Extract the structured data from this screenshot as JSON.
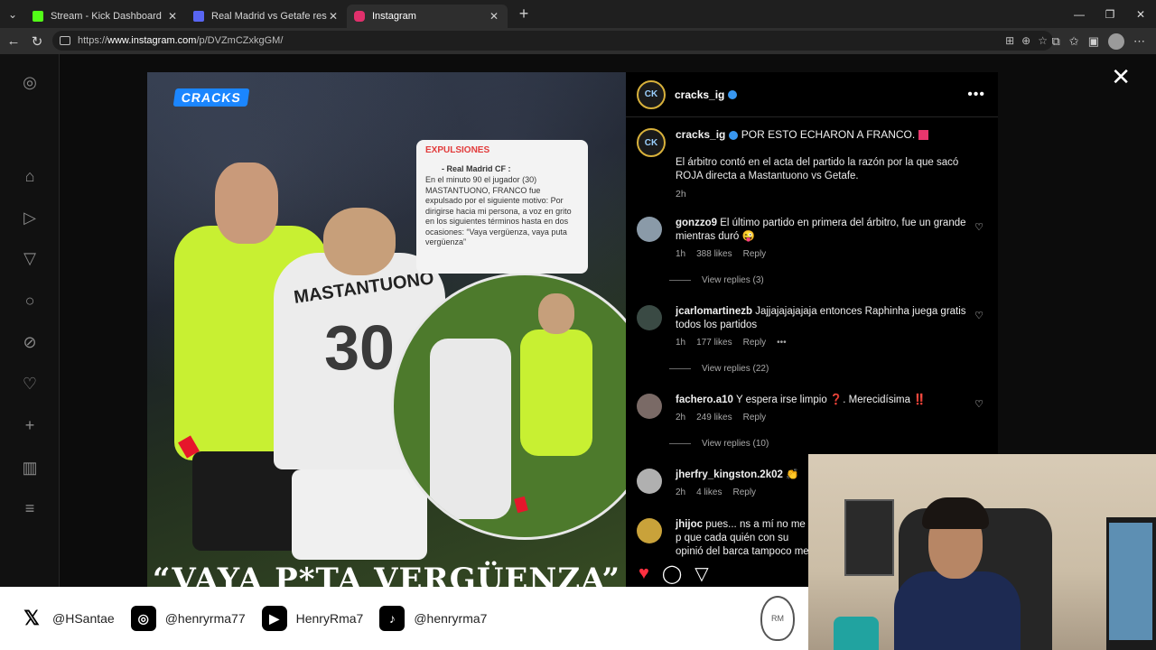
{
  "browser": {
    "tabs": [
      {
        "title": "Stream - Kick Dashboard",
        "favicon_color": "#53fc18",
        "active": false
      },
      {
        "title": "Real Madrid vs Getafe resultados d",
        "favicon_color": "#5865f2",
        "active": false
      },
      {
        "title": "Instagram",
        "favicon_color": "#e1306c",
        "active": true
      }
    ],
    "url_prefix": "https://",
    "url_host": "www.instagram.com",
    "url_path": "/p/DVZmCZxkgGM/"
  },
  "post": {
    "brand": "CRACKS",
    "doc_card": {
      "title": "EXPULSIONES",
      "subtitle": "- Real Madrid CF :",
      "body": "En el minuto 90  el jugador (30) MASTANTUONO, FRANCO  fue expulsado por el siguiente motivo: Por dirigirse hacia mi persona, a voz en grito en los siguientes términos hasta en dos ocasiones: “Vaya vergüenza, vaya puta vergüenza”"
    },
    "player_name": "MASTANTUONO",
    "player_number": "30",
    "headline": "“VAYA P*TA VERGÜENZA”"
  },
  "panel": {
    "account": "cracks_ig",
    "avatar_text": "CK",
    "caption_user": "cracks_ig",
    "caption_title": "POR ESTO ECHARON A FRANCO.",
    "caption_body": "El árbitro contó en el acta del partido la razón por la que sacó ROJA directa a Mastantuono vs Getafe.",
    "caption_time": "2h",
    "comments": [
      {
        "user": "gonzzo9",
        "text": "El último partido en primera del árbitro, fue un grande mientras duró 😜",
        "time": "1h",
        "likes": "388 likes",
        "reply": "Reply",
        "view_replies": "View replies (3)"
      },
      {
        "user": "jcarlomartinezb",
        "text": "Jajjajajajajaja entonces Raphinha juega gratis todos los partidos",
        "time": "1h",
        "likes": "177 likes",
        "reply": "Reply",
        "view_replies": "View replies (22)"
      },
      {
        "user": "fachero.a10",
        "text": "Y espera irse limpio ❓. Merecidísima ‼️",
        "time": "2h",
        "likes": "249 likes",
        "reply": "Reply",
        "view_replies": "View replies (10)"
      },
      {
        "user": "jherfry_kingston.2k02",
        "text": "👏",
        "time": "2h",
        "likes": "4 likes",
        "reply": "Reply"
      },
      {
        "user": "jhijoc",
        "text": "pues... ns a mí no me p que cada quién con su opinió del barca tampoco me parece"
      }
    ]
  },
  "socials": [
    {
      "icon": "x-icon",
      "handle": "@HSantae"
    },
    {
      "icon": "instagram-icon",
      "handle": "@henryrma77"
    },
    {
      "icon": "youtube-icon",
      "handle": "HenryRma7"
    },
    {
      "icon": "tiktok-icon",
      "handle": "@henryrma7"
    }
  ]
}
